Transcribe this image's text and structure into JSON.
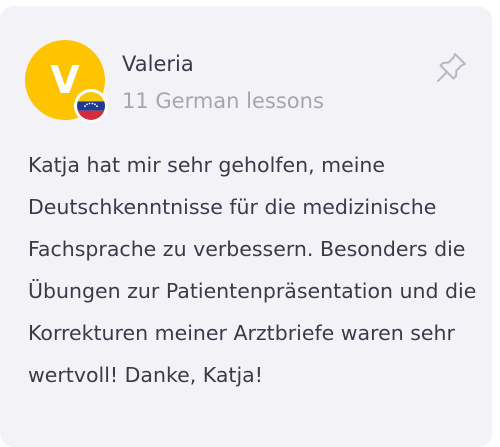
{
  "reviewer": {
    "initial": "V",
    "name": "Valeria",
    "lessons": "11 German lessons"
  },
  "review": {
    "text": "Katja hat mir sehr geholfen, meine Deutschkenntnisse für die medizinische Fachsprache zu verbessern. Besonders die Übungen zur Patientenpräsentation und die Korrekturen meiner Arztbriefe waren sehr wertvoll! Danke, Katja!"
  },
  "colors": {
    "avatar": "#ffc400",
    "card_background": "#f3f2f7",
    "text": "#3c3a4a",
    "muted_text": "#a6a5b0"
  },
  "icons": {
    "flag": "venezuela-flag-icon",
    "pin": "pin-icon"
  }
}
